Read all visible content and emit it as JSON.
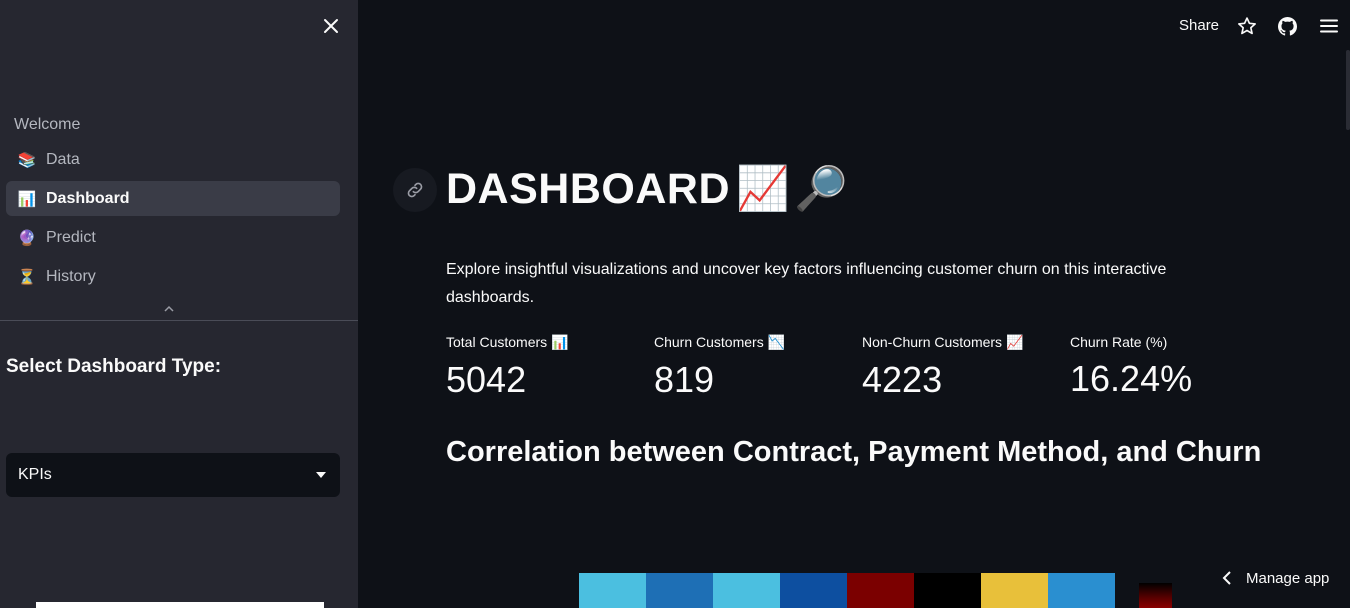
{
  "sidebar": {
    "close_icon": "×",
    "nav_header": "Welcome",
    "items": [
      {
        "label": "Data",
        "icon": "books-icon",
        "glyph": "📚"
      },
      {
        "label": "Dashboard",
        "icon": "bar-chart-icon",
        "glyph": "📊"
      },
      {
        "label": "Predict",
        "icon": "crystal-ball-icon",
        "glyph": "🔮"
      },
      {
        "label": "History",
        "icon": "hourglass-icon",
        "glyph": "⏳"
      }
    ],
    "active_index": 1,
    "select_label": "Select Dashboard Type:",
    "select_value": "KPIs"
  },
  "header": {
    "share_label": "Share"
  },
  "main": {
    "title": "DASHBOARD",
    "title_emoji_1": "📈",
    "title_emoji_2": "🔎",
    "intro": "Explore insightful visualizations and uncover key factors influencing customer churn on this interactive dashboards.",
    "metrics": [
      {
        "label": "Total Customers 📊",
        "value": "5042"
      },
      {
        "label": "Churn Customers 📉",
        "value": "819"
      },
      {
        "label": "Non-Churn Customers 📈",
        "value": "4223"
      },
      {
        "label": "Churn Rate (%)",
        "value": "16.24%"
      }
    ],
    "section_title": "Correlation between Contract, Payment Method, and Churn"
  },
  "heatmap_preview_colors": [
    "#4bbfe0",
    "#1e6fb5",
    "#4bbfe0",
    "#0d4fa0",
    "#7b0000",
    "#000000",
    "#e8c03a",
    "#2a8fd0"
  ],
  "manage_app_label": "Manage app",
  "colors": {
    "background": "#0e1117",
    "sidebar": "#262730",
    "active_nav": "#3a3c47"
  }
}
